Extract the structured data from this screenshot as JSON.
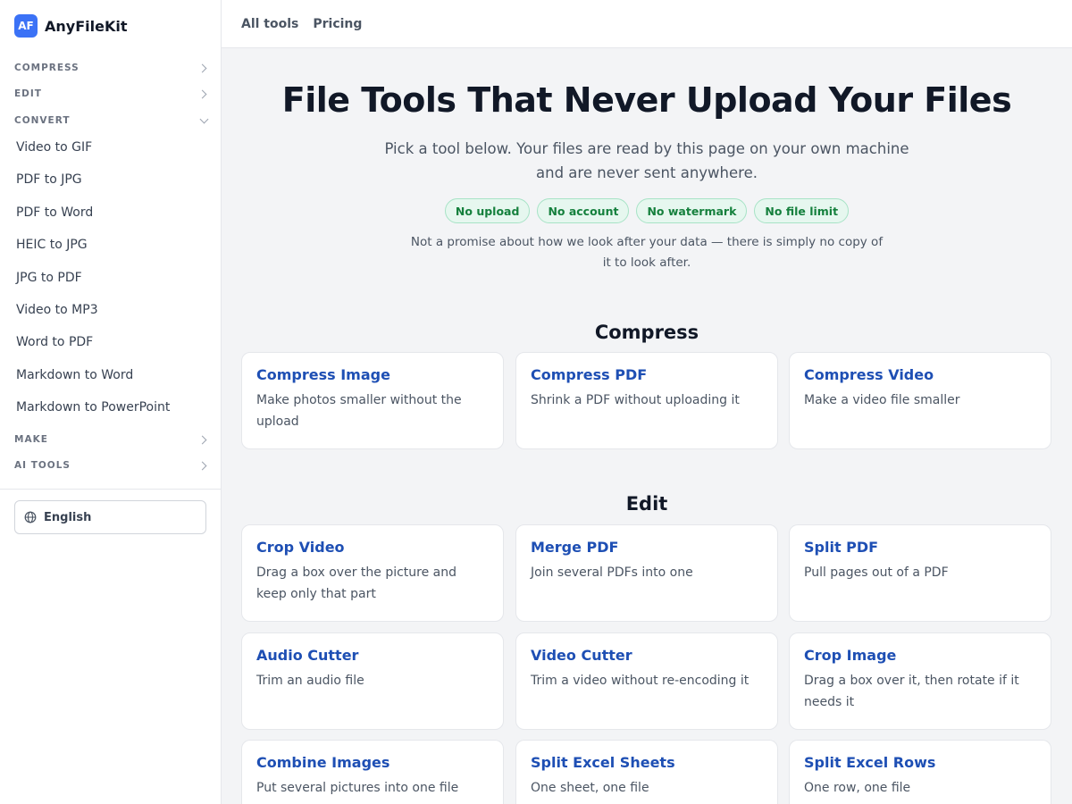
{
  "brand": {
    "logo_text": "AF",
    "name": "AnyFileKit",
    "color": "#3b72f6"
  },
  "sidebar": {
    "groups": {
      "compress": "COMPRESS",
      "edit": "EDIT",
      "convert": "CONVERT",
      "make": "MAKE",
      "ai_tools": "AI TOOLS"
    },
    "convert_items": [
      "Video to GIF",
      "PDF to JPG",
      "PDF to Word",
      "HEIC to JPG",
      "JPG to PDF",
      "Video to MP3",
      "Word to PDF",
      "Markdown to Word",
      "Markdown to PowerPoint"
    ],
    "language": {
      "label": "English",
      "icon": "globe-icon"
    }
  },
  "topnav": {
    "all_tools": "All tools",
    "pricing": "Pricing"
  },
  "hero": {
    "title": "File Tools That Never Upload Your Files",
    "subtitle": "Pick a tool below. Your files are read by this page on your own machine and are never sent anywhere.",
    "badges": [
      "No upload",
      "No account",
      "No watermark",
      "No file limit"
    ],
    "note": "Not a promise about how we look after your data — there is simply no copy of it to look after."
  },
  "sections": {
    "compress": {
      "title": "Compress",
      "cards": [
        {
          "title": "Compress Image",
          "desc": "Make photos smaller without the upload"
        },
        {
          "title": "Compress PDF",
          "desc": "Shrink a PDF without uploading it"
        },
        {
          "title": "Compress Video",
          "desc": "Make a video file smaller"
        }
      ]
    },
    "edit": {
      "title": "Edit",
      "cards": [
        {
          "title": "Crop Video",
          "desc": "Drag a box over the picture and keep only that part"
        },
        {
          "title": "Merge PDF",
          "desc": "Join several PDFs into one"
        },
        {
          "title": "Split PDF",
          "desc": "Pull pages out of a PDF"
        },
        {
          "title": "Audio Cutter",
          "desc": "Trim an audio file"
        },
        {
          "title": "Video Cutter",
          "desc": "Trim a video without re-encoding it"
        },
        {
          "title": "Crop Image",
          "desc": "Drag a box over it, then rotate if it needs it"
        },
        {
          "title": "Combine Images",
          "desc": "Put several pictures into one file"
        },
        {
          "title": "Split Excel Sheets",
          "desc": "One sheet, one file"
        },
        {
          "title": "Split Excel Rows",
          "desc": "One row, one file"
        }
      ]
    }
  },
  "colors": {
    "link_blue": "#1e4fb4",
    "badge_green": "#15803d",
    "badge_bg": "#e6f7ef"
  }
}
